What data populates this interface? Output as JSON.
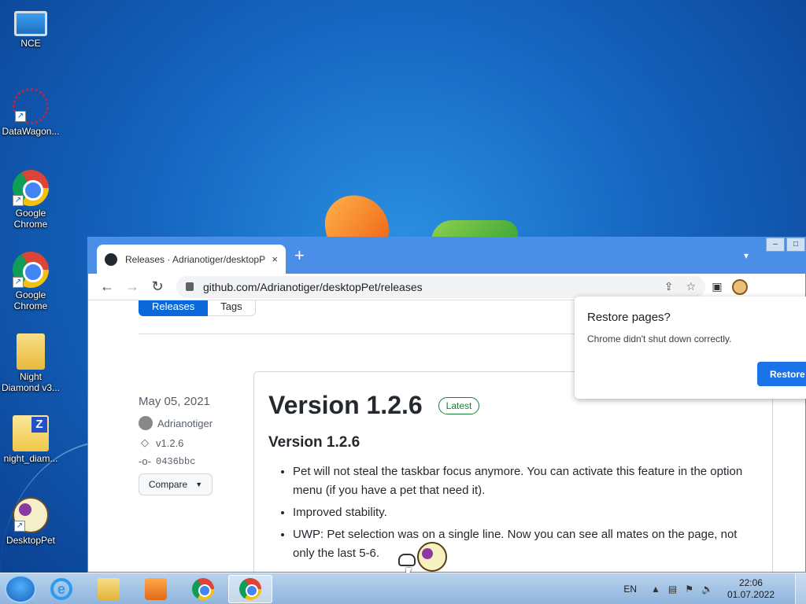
{
  "desktop": {
    "icons": [
      {
        "label": "NCE"
      },
      {
        "label": "DataWagon..."
      },
      {
        "label": "Google Chrome"
      },
      {
        "label": "Google Chrome"
      },
      {
        "label": "Night Diamond v3..."
      },
      {
        "label": "night_diam..."
      },
      {
        "label": "DesktopPet"
      }
    ],
    "zip_letter": "Z",
    "shortcut_glyph": "↗"
  },
  "browser": {
    "tab_title": "Releases · Adrianotiger/desktopP",
    "tab_close": "×",
    "new_tab": "+",
    "tab_dropdown": "▾",
    "window_buttons": {
      "minimize": "–",
      "maximize": "□"
    },
    "nav": {
      "back": "←",
      "forward": "→",
      "reload": "↻"
    },
    "url": "github.com/Adrianotiger/desktopPet/releases",
    "icons": {
      "share": "⇪",
      "star": "☆",
      "sidepanel": "▣"
    }
  },
  "page": {
    "subnav": {
      "releases": "Releases",
      "tags": "Tags"
    },
    "release": {
      "date": "May 05, 2021",
      "author": "Adrianotiger",
      "tag": "v1.2.6",
      "commit": "0436bbc",
      "compare": "Compare",
      "title": "Version 1.2.6",
      "badge": "Latest",
      "heading": "Version 1.2.6",
      "notes": [
        "Pet will not steal the taskbar focus anymore. You can activate this feature in the option menu (if you have a pet that need it).",
        "Improved stability.",
        "UWP: Pet selection was on a single line. Now you can see all mates on the page, not only the last 5-6."
      ]
    }
  },
  "restore_popup": {
    "title": "Restore pages?",
    "message": "Chrome didn't shut down correctly.",
    "button": "Restore"
  },
  "taskbar": {
    "ie_glyph": "e",
    "language": "EN",
    "tray_icons": {
      "show_hidden": "▲",
      "network": "▤",
      "flag": "⚑",
      "volume": "🔈"
    },
    "time": "22:06",
    "date": "01.07.2022"
  }
}
